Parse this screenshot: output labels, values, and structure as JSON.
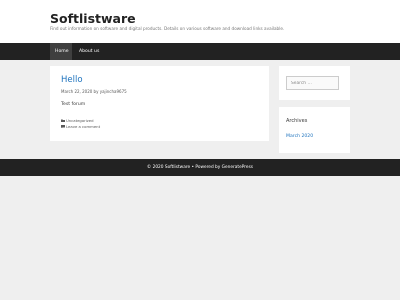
{
  "site": {
    "title": "Softlistware",
    "description": "Find out information on software and digital products. Details on various software and download links available."
  },
  "nav": {
    "items": [
      {
        "label": "Home"
      },
      {
        "label": "About us"
      }
    ]
  },
  "post": {
    "title": "Hello",
    "meta": "March 22, 2020 by yajincha9675",
    "content": "Test forum",
    "category": "Uncategorized",
    "comment_link": "Leave a comment",
    "category_icon": "folder-icon",
    "comment_icon": "comment-icon"
  },
  "sidebar": {
    "search_placeholder": "Search …",
    "archives_title": "Archives",
    "archive_items": [
      {
        "label": "March 2020"
      }
    ]
  },
  "footer": {
    "text": "© 2020 Softlistware • Powered by GeneratePress"
  },
  "colors": {
    "link": "#1e73be",
    "nav_background": "#222222",
    "nav_active": "#3f3f3f",
    "page_background": "#efefef"
  }
}
